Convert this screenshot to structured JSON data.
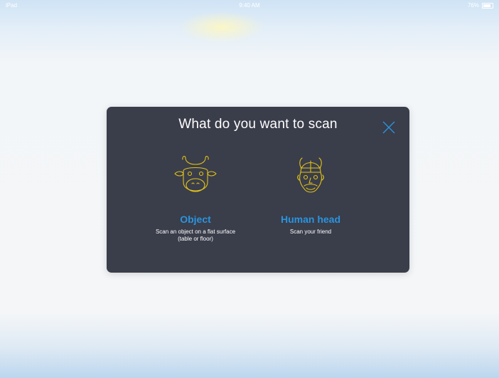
{
  "status_bar": {
    "device": "iPad",
    "time": "9:40 AM",
    "battery": "76%"
  },
  "dialog": {
    "title": "What do you want to scan"
  },
  "options": [
    {
      "title": "Object",
      "description_line1": "Scan an object on a flat surface",
      "description_line2": "(table or floor)",
      "icon": "bull-face-icon"
    },
    {
      "title": "Human head",
      "description_line1": "Scan your friend",
      "icon": "viking-head-icon"
    }
  ],
  "colors": {
    "dialog_bg": "#3a3d4a",
    "accent_blue": "#2a94de",
    "icon_yellow": "#e1c318",
    "close_icon": "#2a94de"
  }
}
